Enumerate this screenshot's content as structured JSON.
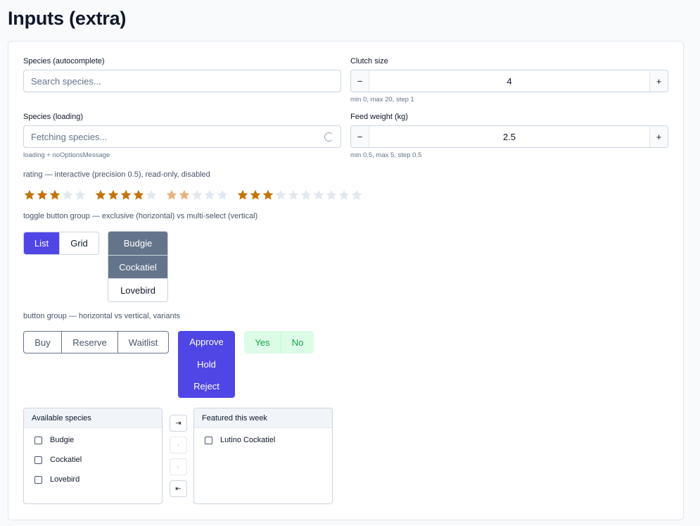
{
  "page": {
    "title": "Inputs (extra)"
  },
  "autocomplete": {
    "label": "Species (autocomplete)",
    "placeholder": "Search species..."
  },
  "loading_field": {
    "label": "Species (loading)",
    "placeholder": "Fetching species...",
    "hint": "loading + noOptionsMessage"
  },
  "clutch": {
    "label": "Clutch size",
    "minus": "−",
    "plus": "+",
    "value": "4",
    "hint": "min 0, max 20, step 1"
  },
  "feed": {
    "label": "Feed weight (kg)",
    "minus": "−",
    "plus": "+",
    "value": "2.5",
    "hint": "min 0.5, max 5, step 0.5"
  },
  "rating": {
    "label": "rating — interactive (precision 0.5), read-only, disabled",
    "color_filled": "#c2740c",
    "color_disabled": "#e8b37a",
    "color_empty": "#e2e8f0",
    "ratings": [
      {
        "value": 3,
        "max": 5,
        "state": "interactive"
      },
      {
        "value": 4,
        "max": 5,
        "state": "read-only"
      },
      {
        "value": 2,
        "max": 5,
        "state": "disabled"
      },
      {
        "value": 3,
        "max": 10,
        "state": "interactive"
      }
    ]
  },
  "toggle": {
    "label": "toggle button group — exclusive (horizontal) vs multi-select (vertical)",
    "exclusive": [
      {
        "label": "List",
        "selected": true
      },
      {
        "label": "Grid",
        "selected": false
      }
    ],
    "multi": [
      {
        "label": "Budgie",
        "selected": true
      },
      {
        "label": "Cockatiel",
        "selected": true
      },
      {
        "label": "Lovebird",
        "selected": false
      }
    ]
  },
  "button_group": {
    "label": "button group — horizontal vs vertical, variants",
    "outline": [
      "Buy",
      "Reserve",
      "Waitlist"
    ],
    "vertical": [
      "Approve",
      "Hold",
      "Reject"
    ],
    "soft": [
      "Yes",
      "No"
    ]
  },
  "transfer": {
    "left_title": "Available species",
    "left_items": [
      "Budgie",
      "Cockatiel",
      "Lovebird"
    ],
    "right_title": "Featured this week",
    "right_items": [
      "Lutino Cockatiel"
    ],
    "buttons": [
      {
        "icon": "⇥",
        "name": "move-all-right",
        "disabled": false
      },
      {
        "icon": "›",
        "name": "move-selected-right",
        "disabled": true
      },
      {
        "icon": "‹",
        "name": "move-selected-left",
        "disabled": true
      },
      {
        "icon": "⇤",
        "name": "move-all-left",
        "disabled": false
      }
    ]
  }
}
